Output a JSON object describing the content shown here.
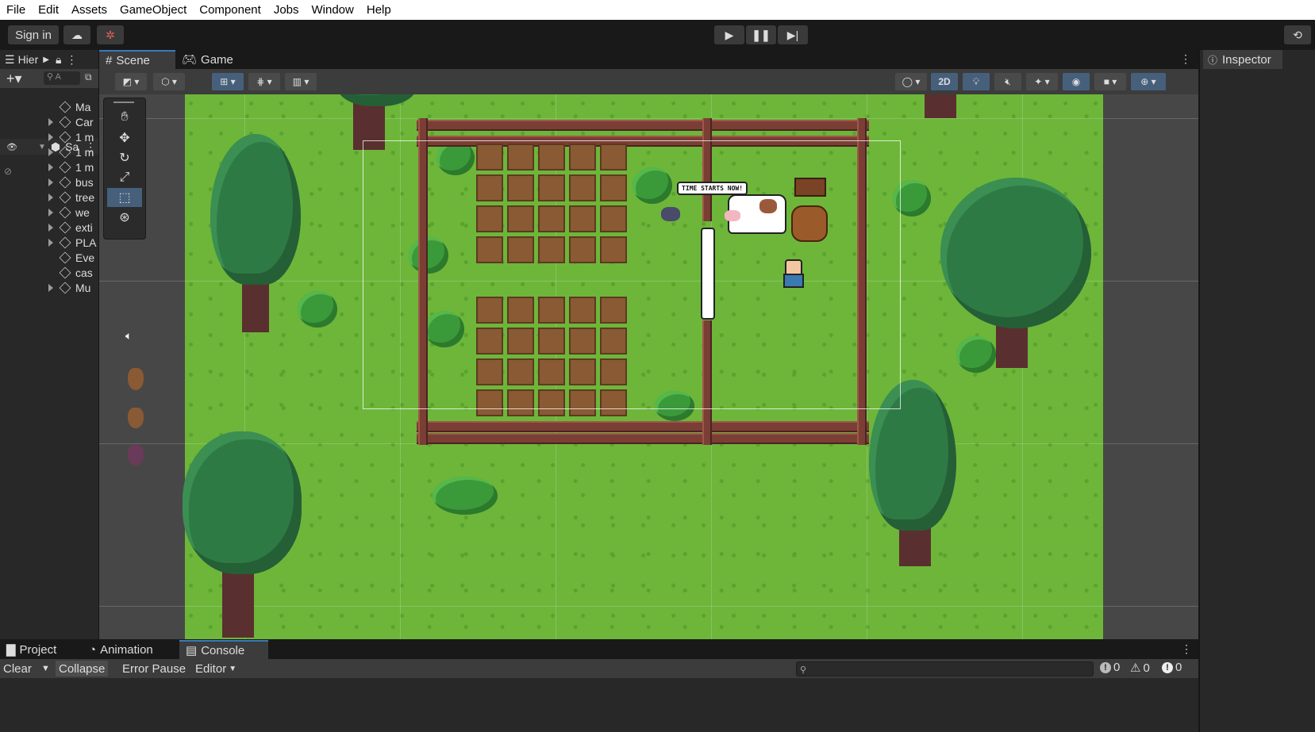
{
  "menu": [
    "File",
    "Edit",
    "Assets",
    "GameObject",
    "Component",
    "Jobs",
    "Window",
    "Help"
  ],
  "toolbar": {
    "sign_in": "Sign in"
  },
  "hierarchy": {
    "tab_label": "Hier",
    "search_placeholder": "A",
    "scene_name": "Sa",
    "items": [
      "Ma",
      "Car",
      "1 m",
      "1 m",
      "1 m",
      "bus",
      "tree",
      "we",
      "exti",
      "PLA",
      "Eve",
      "cas",
      "Mu"
    ]
  },
  "scene": {
    "tabs": [
      "Scene",
      "Game"
    ],
    "mode_2d": "2D",
    "speech": "TIME STARTS NOW!"
  },
  "inspector": {
    "tab_label": "Inspector"
  },
  "console": {
    "tabs": [
      "Project",
      "Animation",
      "Console"
    ],
    "clear": "Clear",
    "collapse": "Collapse",
    "error_pause": "Error Pause",
    "editor": "Editor",
    "log_count": "0",
    "warning_count": "0",
    "error_count": "0"
  },
  "colors": {
    "accent": "#46607c",
    "grass": "#6db63a",
    "tab_active": "#3a79bb"
  }
}
